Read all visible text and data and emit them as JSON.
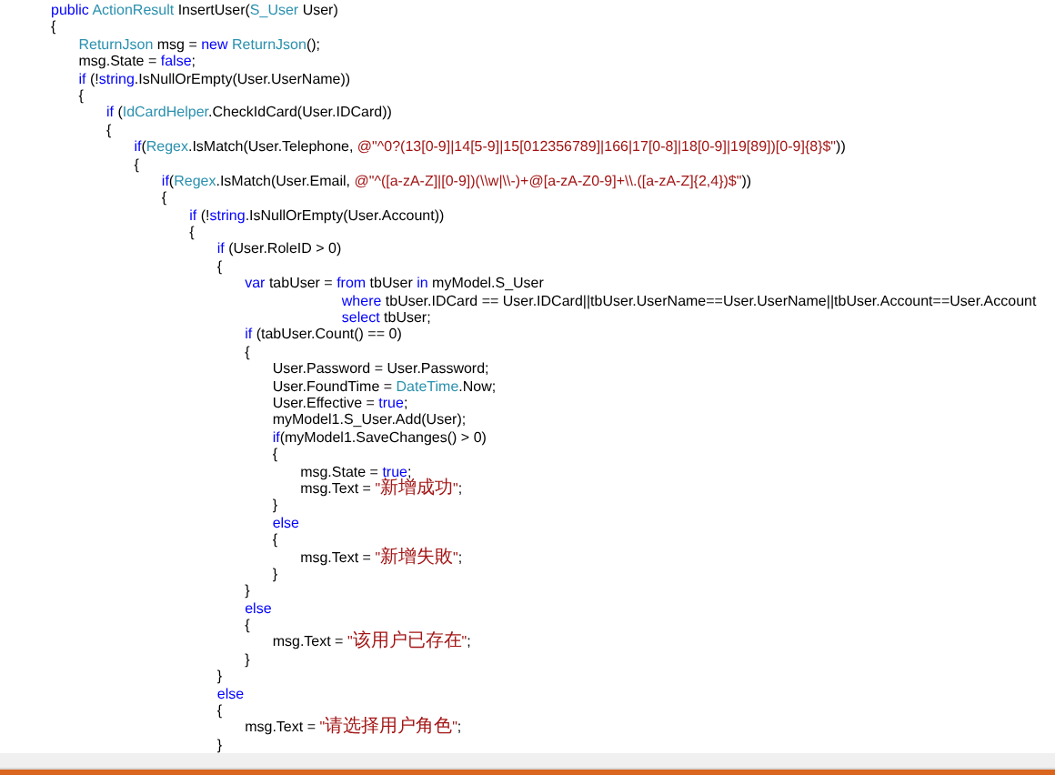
{
  "editor": {
    "lines": [
      {
        "tokens": [
          {
            "kind": "kw",
            "text": "public "
          },
          {
            "kind": "type",
            "text": "ActionResult"
          },
          {
            "kind": "plain",
            "text": " InsertUser("
          },
          {
            "kind": "type",
            "text": "S_User"
          },
          {
            "kind": "plain",
            "text": " User)"
          }
        ]
      },
      {
        "tokens": [
          {
            "kind": "plain",
            "text": "{"
          }
        ]
      },
      {
        "tokens": [
          {
            "kind": "type",
            "text": "    ReturnJson"
          },
          {
            "kind": "plain",
            "text": " msg = "
          },
          {
            "kind": "kw",
            "text": "new "
          },
          {
            "kind": "type",
            "text": "ReturnJson"
          },
          {
            "kind": "plain",
            "text": "();"
          }
        ]
      },
      {
        "tokens": [
          {
            "kind": "plain",
            "text": "    msg.State = "
          },
          {
            "kind": "kw",
            "text": "false"
          },
          {
            "kind": "plain",
            "text": ";"
          }
        ]
      },
      {
        "tokens": [
          {
            "kind": "kw",
            "text": "    if"
          },
          {
            "kind": "plain",
            "text": " (!"
          },
          {
            "kind": "kw",
            "text": "string"
          },
          {
            "kind": "plain",
            "text": ".IsNullOrEmpty(User.UserName))"
          }
        ]
      },
      {
        "tokens": [
          {
            "kind": "plain",
            "text": "    {"
          }
        ]
      },
      {
        "tokens": [
          {
            "kind": "kw",
            "text": "        if"
          },
          {
            "kind": "plain",
            "text": " ("
          },
          {
            "kind": "type",
            "text": "IdCardHelper"
          },
          {
            "kind": "plain",
            "text": ".CheckIdCard(User.IDCard))"
          }
        ]
      },
      {
        "tokens": [
          {
            "kind": "plain",
            "text": "        {"
          }
        ]
      },
      {
        "tokens": [
          {
            "kind": "kw",
            "text": "            if"
          },
          {
            "kind": "plain",
            "text": "("
          },
          {
            "kind": "type",
            "text": "Regex"
          },
          {
            "kind": "plain",
            "text": ".IsMatch(User.Telephone, "
          },
          {
            "kind": "str",
            "text": "@\"^0?(13[0-9]|14[5-9]|15[012356789]|166|17[0-8]|18[0-9]|19[89])[0-9]{8}$\""
          },
          {
            "kind": "plain",
            "text": "))"
          }
        ]
      },
      {
        "tokens": [
          {
            "kind": "plain",
            "text": "            {"
          }
        ]
      },
      {
        "tokens": [
          {
            "kind": "kw",
            "text": "                if"
          },
          {
            "kind": "plain",
            "text": "("
          },
          {
            "kind": "type",
            "text": "Regex"
          },
          {
            "kind": "plain",
            "text": ".IsMatch(User.Email, "
          },
          {
            "kind": "str",
            "text": "@\"^([a-zA-Z]|[0-9])(\\\\w|\\\\-)+@[a-zA-Z0-9]+\\\\.([a-zA-Z]{2,4})$\""
          },
          {
            "kind": "plain",
            "text": "))"
          }
        ]
      },
      {
        "tokens": [
          {
            "kind": "plain",
            "text": "                {"
          }
        ]
      },
      {
        "tokens": [
          {
            "kind": "kw",
            "text": "                    if"
          },
          {
            "kind": "plain",
            "text": " (!"
          },
          {
            "kind": "kw",
            "text": "string"
          },
          {
            "kind": "plain",
            "text": ".IsNullOrEmpty(User.Account))"
          }
        ]
      },
      {
        "tokens": [
          {
            "kind": "plain",
            "text": "                    {"
          }
        ]
      },
      {
        "tokens": [
          {
            "kind": "kw",
            "text": "                        if"
          },
          {
            "kind": "plain",
            "text": " (User.RoleID > 0)"
          }
        ]
      },
      {
        "tokens": [
          {
            "kind": "plain",
            "text": "                        {"
          }
        ]
      },
      {
        "tokens": [
          {
            "kind": "kw",
            "text": "                            var"
          },
          {
            "kind": "plain",
            "text": " tabUser = "
          },
          {
            "kind": "kw",
            "text": "from"
          },
          {
            "kind": "plain",
            "text": " tbUser "
          },
          {
            "kind": "kw",
            "text": "in"
          },
          {
            "kind": "plain",
            "text": " myModel.S_User"
          }
        ]
      },
      {
        "tokens": [
          {
            "kind": "kw",
            "text": "                                          where"
          },
          {
            "kind": "plain",
            "text": " tbUser.IDCard == User.IDCard||tbUser.UserName==User.UserName||tbUser.Account==User.Account"
          }
        ]
      },
      {
        "tokens": [
          {
            "kind": "kw",
            "text": "                                          select"
          },
          {
            "kind": "plain",
            "text": " tbUser;"
          }
        ]
      },
      {
        "tokens": [
          {
            "kind": "kw",
            "text": "                            if"
          },
          {
            "kind": "plain",
            "text": " (tabUser.Count() == 0)"
          }
        ]
      },
      {
        "tokens": [
          {
            "kind": "plain",
            "text": "                            {"
          }
        ]
      },
      {
        "tokens": [
          {
            "kind": "plain",
            "text": "                                User.Password = User.Password;"
          }
        ]
      },
      {
        "tokens": [
          {
            "kind": "plain",
            "text": "                                User.FoundTime = "
          },
          {
            "kind": "type",
            "text": "DateTime"
          },
          {
            "kind": "plain",
            "text": ".Now;"
          }
        ]
      },
      {
        "tokens": [
          {
            "kind": "plain",
            "text": "                                User.Effective = "
          },
          {
            "kind": "kw",
            "text": "true"
          },
          {
            "kind": "plain",
            "text": ";"
          }
        ]
      },
      {
        "tokens": [
          {
            "kind": "plain",
            "text": "                                myModel1.S_User.Add(User);"
          }
        ]
      },
      {
        "tokens": [
          {
            "kind": "kw",
            "text": "                                if"
          },
          {
            "kind": "plain",
            "text": "(myModel1.SaveChanges() > 0)"
          }
        ]
      },
      {
        "tokens": [
          {
            "kind": "plain",
            "text": "                                {"
          }
        ]
      },
      {
        "tokens": [
          {
            "kind": "plain",
            "text": "                                    msg.State = "
          },
          {
            "kind": "kw",
            "text": "true"
          },
          {
            "kind": "plain",
            "text": ";"
          }
        ]
      },
      {
        "tokens": [
          {
            "kind": "plain",
            "text": "                                    msg.Text = "
          },
          {
            "kind": "str",
            "text": "\"新增成功\""
          },
          {
            "kind": "plain",
            "text": ";"
          }
        ]
      },
      {
        "tokens": [
          {
            "kind": "plain",
            "text": "                                }"
          }
        ]
      },
      {
        "tokens": [
          {
            "kind": "kw",
            "text": "                                else"
          }
        ]
      },
      {
        "tokens": [
          {
            "kind": "plain",
            "text": "                                {"
          }
        ]
      },
      {
        "tokens": [
          {
            "kind": "plain",
            "text": "                                    msg.Text = "
          },
          {
            "kind": "str",
            "text": "\"新增失敗\""
          },
          {
            "kind": "plain",
            "text": ";"
          }
        ]
      },
      {
        "tokens": [
          {
            "kind": "plain",
            "text": "                                }"
          }
        ]
      },
      {
        "tokens": [
          {
            "kind": "plain",
            "text": "                            }"
          }
        ]
      },
      {
        "tokens": [
          {
            "kind": "kw",
            "text": "                            else"
          }
        ]
      },
      {
        "tokens": [
          {
            "kind": "plain",
            "text": "                            {"
          }
        ]
      },
      {
        "tokens": [
          {
            "kind": "plain",
            "text": "                                msg.Text = "
          },
          {
            "kind": "str",
            "text": "\"该用户已存在\""
          },
          {
            "kind": "plain",
            "text": ";"
          }
        ]
      },
      {
        "tokens": [
          {
            "kind": "plain",
            "text": "                            }"
          }
        ]
      },
      {
        "tokens": [
          {
            "kind": "plain",
            "text": "                        }"
          }
        ]
      },
      {
        "tokens": [
          {
            "kind": "kw",
            "text": "                        else"
          }
        ]
      },
      {
        "tokens": [
          {
            "kind": "plain",
            "text": "                        {"
          }
        ]
      },
      {
        "tokens": [
          {
            "kind": "plain",
            "text": "                            msg.Text = "
          },
          {
            "kind": "str",
            "text": "\"请选择用户角色\""
          },
          {
            "kind": "plain",
            "text": ";"
          }
        ]
      },
      {
        "tokens": [
          {
            "kind": "plain",
            "text": "                        }"
          }
        ]
      }
    ]
  }
}
